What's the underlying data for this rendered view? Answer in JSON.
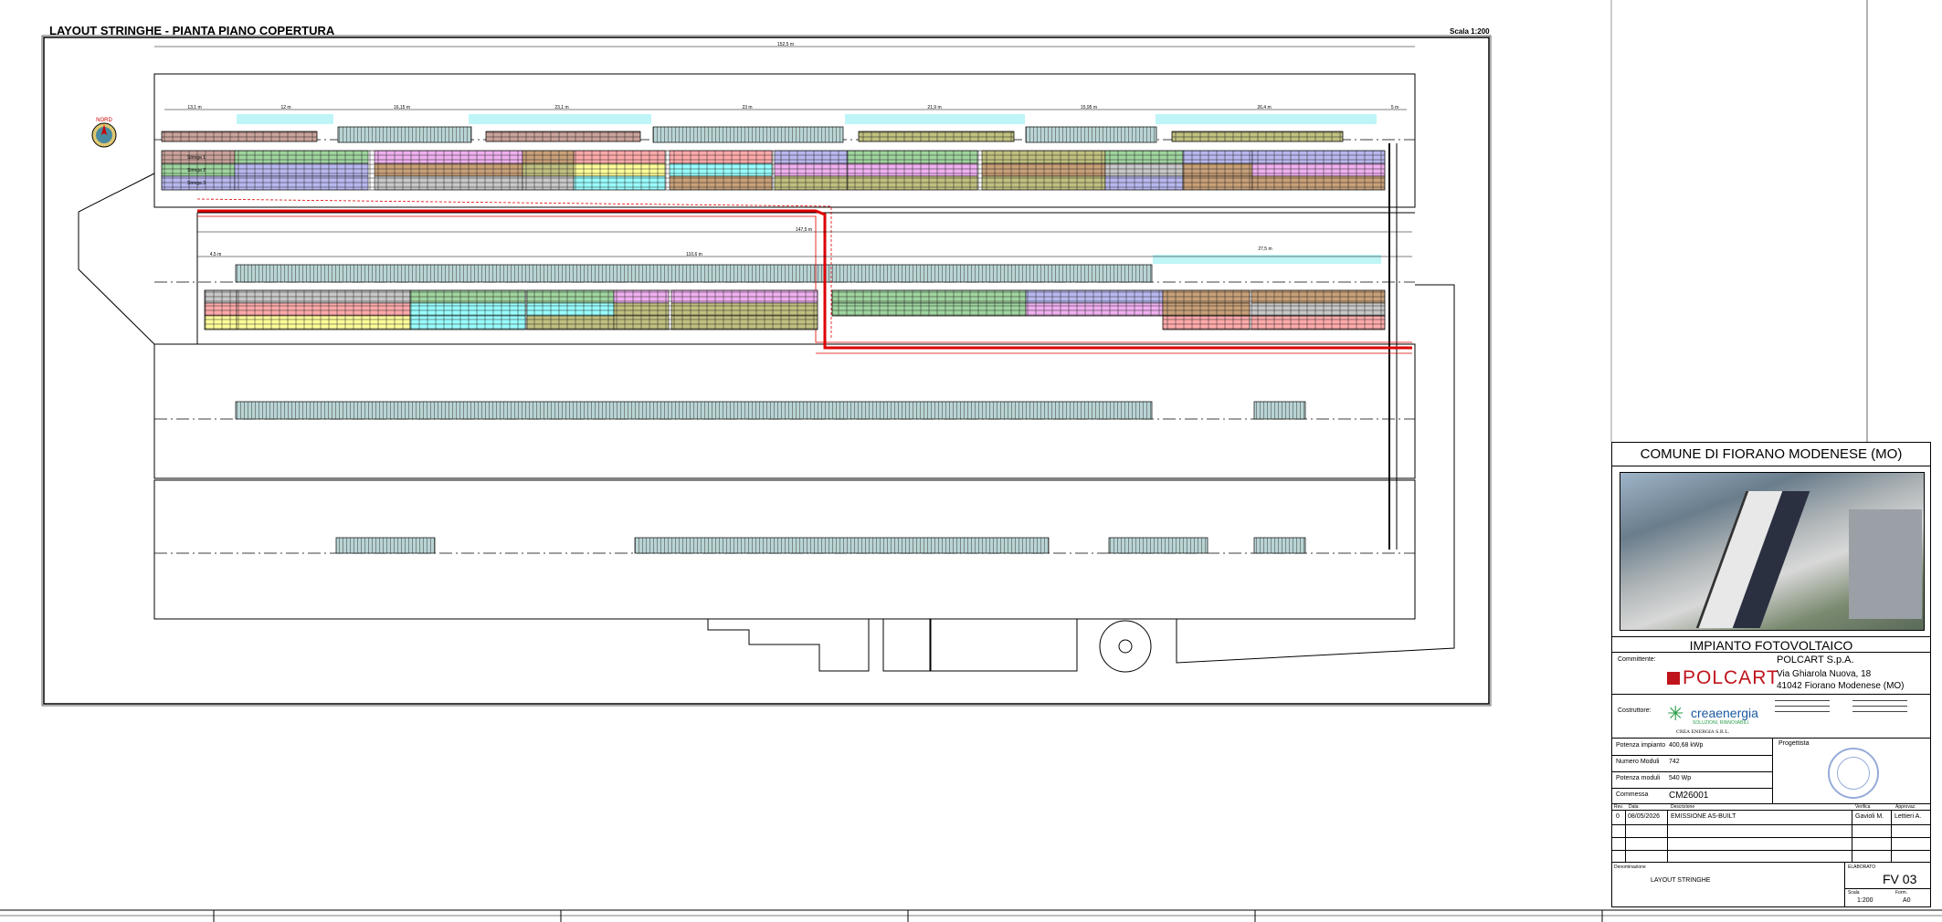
{
  "drawing": {
    "title": "LAYOUT STRINGHE - PIANTA PIANO COPERTURA",
    "scale": "Scala 1:200",
    "north_label": "NORD",
    "dimensions_top": [
      "152,5 m",
      "13,1 m",
      "12 m",
      "16,15 m",
      "23,1 m",
      "23 m",
      "21,9 m",
      "15,95 m",
      "26,4 m",
      "5 m"
    ],
    "dimensions_mid": [
      "147,5 m",
      "4,5 m",
      "110,6 m",
      "27,5 m"
    ],
    "row_labels_top": [
      "Stringa 1",
      "Stringa 2",
      "Stringa 3"
    ],
    "accent_colors": [
      "#c9a29a",
      "#9fd59f",
      "#b8b8f0",
      "#f0b0f0",
      "#ffff99",
      "#99ffff",
      "#c8a078",
      "#c8c8c8",
      "#ffaaaa",
      "#c0c080"
    ]
  },
  "title_block": {
    "municipality": "COMUNE DI FIORANO MODENESE (MO)",
    "project": "IMPIANTO FOTOVOLTAICO",
    "client_label": "Committente:",
    "client_name": "POLCART S.p.A.",
    "client_address1": "Via Ghiarola Nuova, 18",
    "client_address2": "41042 Fiorano Modenese (MO)",
    "client_logo": "POLCART",
    "builder_label": "Costruttore:",
    "builder_logo": "creaenergia",
    "builder_tagline": "SOLUZIONI, RINNOVABILI.",
    "builder_sign": "CREA ENERGIA S.R.L.",
    "power_label": "Potenza impianto",
    "power_value": "400,68 kWp",
    "modules_label": "Numero Moduli",
    "modules_value": "742",
    "module_power_label": "Potenza moduli",
    "module_power_value": "540 Wp",
    "order_label": "Commessa",
    "order_value": "CM26001",
    "designer_label": "Progettista",
    "rev_headers": [
      "Rev.",
      "Data",
      "Descrizione",
      "Verifica",
      "Approvaz."
    ],
    "rev_row": [
      "0",
      "08/05/2026",
      "EMISSIONE AS-BUILT",
      "Gavioli M.",
      "Lettieri A."
    ],
    "name_label": "Denominazione",
    "name_value": "LAYOUT STRINGHE",
    "elab_label": "ELABORATO",
    "elab_value": "FV 03",
    "scale_label": "Scala",
    "scale_value": "1:200",
    "format_label": "Form.",
    "format_value": "A0"
  }
}
